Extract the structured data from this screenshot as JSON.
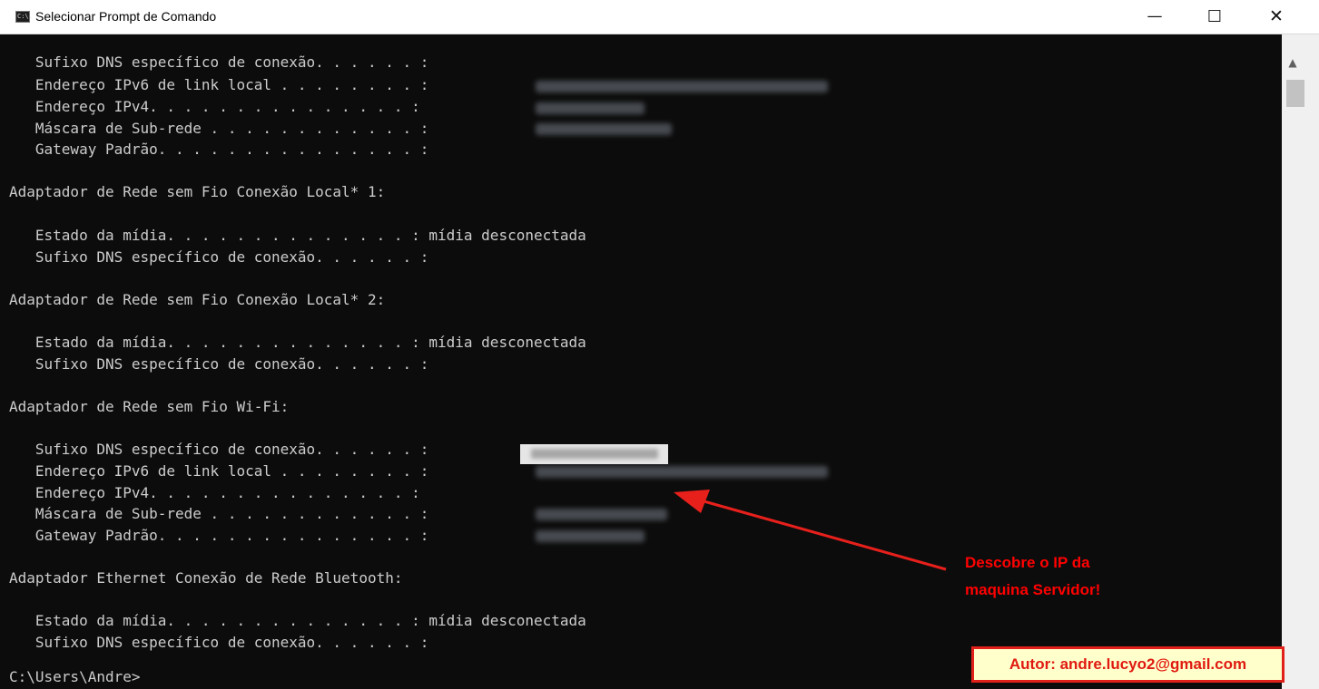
{
  "window": {
    "title": "Selecionar Prompt de Comando",
    "icon_text": "C:\\.",
    "controls": {
      "minimize": "—",
      "maximize": "☐",
      "close": "✕"
    }
  },
  "console": {
    "lines": [
      "   Sufixo DNS específico de conexão. . . . . . :",
      "   Endereço IPv6 de link local . . . . . . . . :",
      "   Endereço IPv4. . . . . . . . . . . . . . . :",
      "   Máscara de Sub-rede . . . . . . . . . . . . :",
      "   Gateway Padrão. . . . . . . . . . . . . . . :",
      "",
      "Adaptador de Rede sem Fio Conexão Local* 1:",
      "",
      "   Estado da mídia. . . . . . . . . . . . . . : mídia desconectada",
      "   Sufixo DNS específico de conexão. . . . . . :",
      "",
      "Adaptador de Rede sem Fio Conexão Local* 2:",
      "",
      "   Estado da mídia. . . . . . . . . . . . . . : mídia desconectada",
      "   Sufixo DNS específico de conexão. . . . . . :",
      "",
      "Adaptador de Rede sem Fio Wi-Fi:",
      "",
      "   Sufixo DNS específico de conexão. . . . . . :",
      "   Endereço IPv6 de link local . . . . . . . . :",
      "   Endereço IPv4. . . . . . . . . . . . . . . :",
      "   Máscara de Sub-rede . . . . . . . . . . . . :",
      "   Gateway Padrão. . . . . . . . . . . . . . . :",
      "",
      "Adaptador Ethernet Conexão de Rede Bluetooth:",
      "",
      "   Estado da mídia. . . . . . . . . . . . . . : mídia desconectada",
      "   Sufixo DNS específico de conexão. . . . . . :",
      "",
      "C:\\Users\\Andre>"
    ]
  },
  "annotation": {
    "line1": "Descobre o IP da",
    "line2": "maquina Servidor!",
    "color": "#ff0000"
  },
  "author": {
    "text": "Autor: andre.lucyo2@gmail.com",
    "border_color": "#e0201a",
    "background": "#ffffcc"
  },
  "colors": {
    "console_bg": "#0c0c0c",
    "console_text": "#cccccc",
    "titlebar_bg": "#ffffff"
  }
}
